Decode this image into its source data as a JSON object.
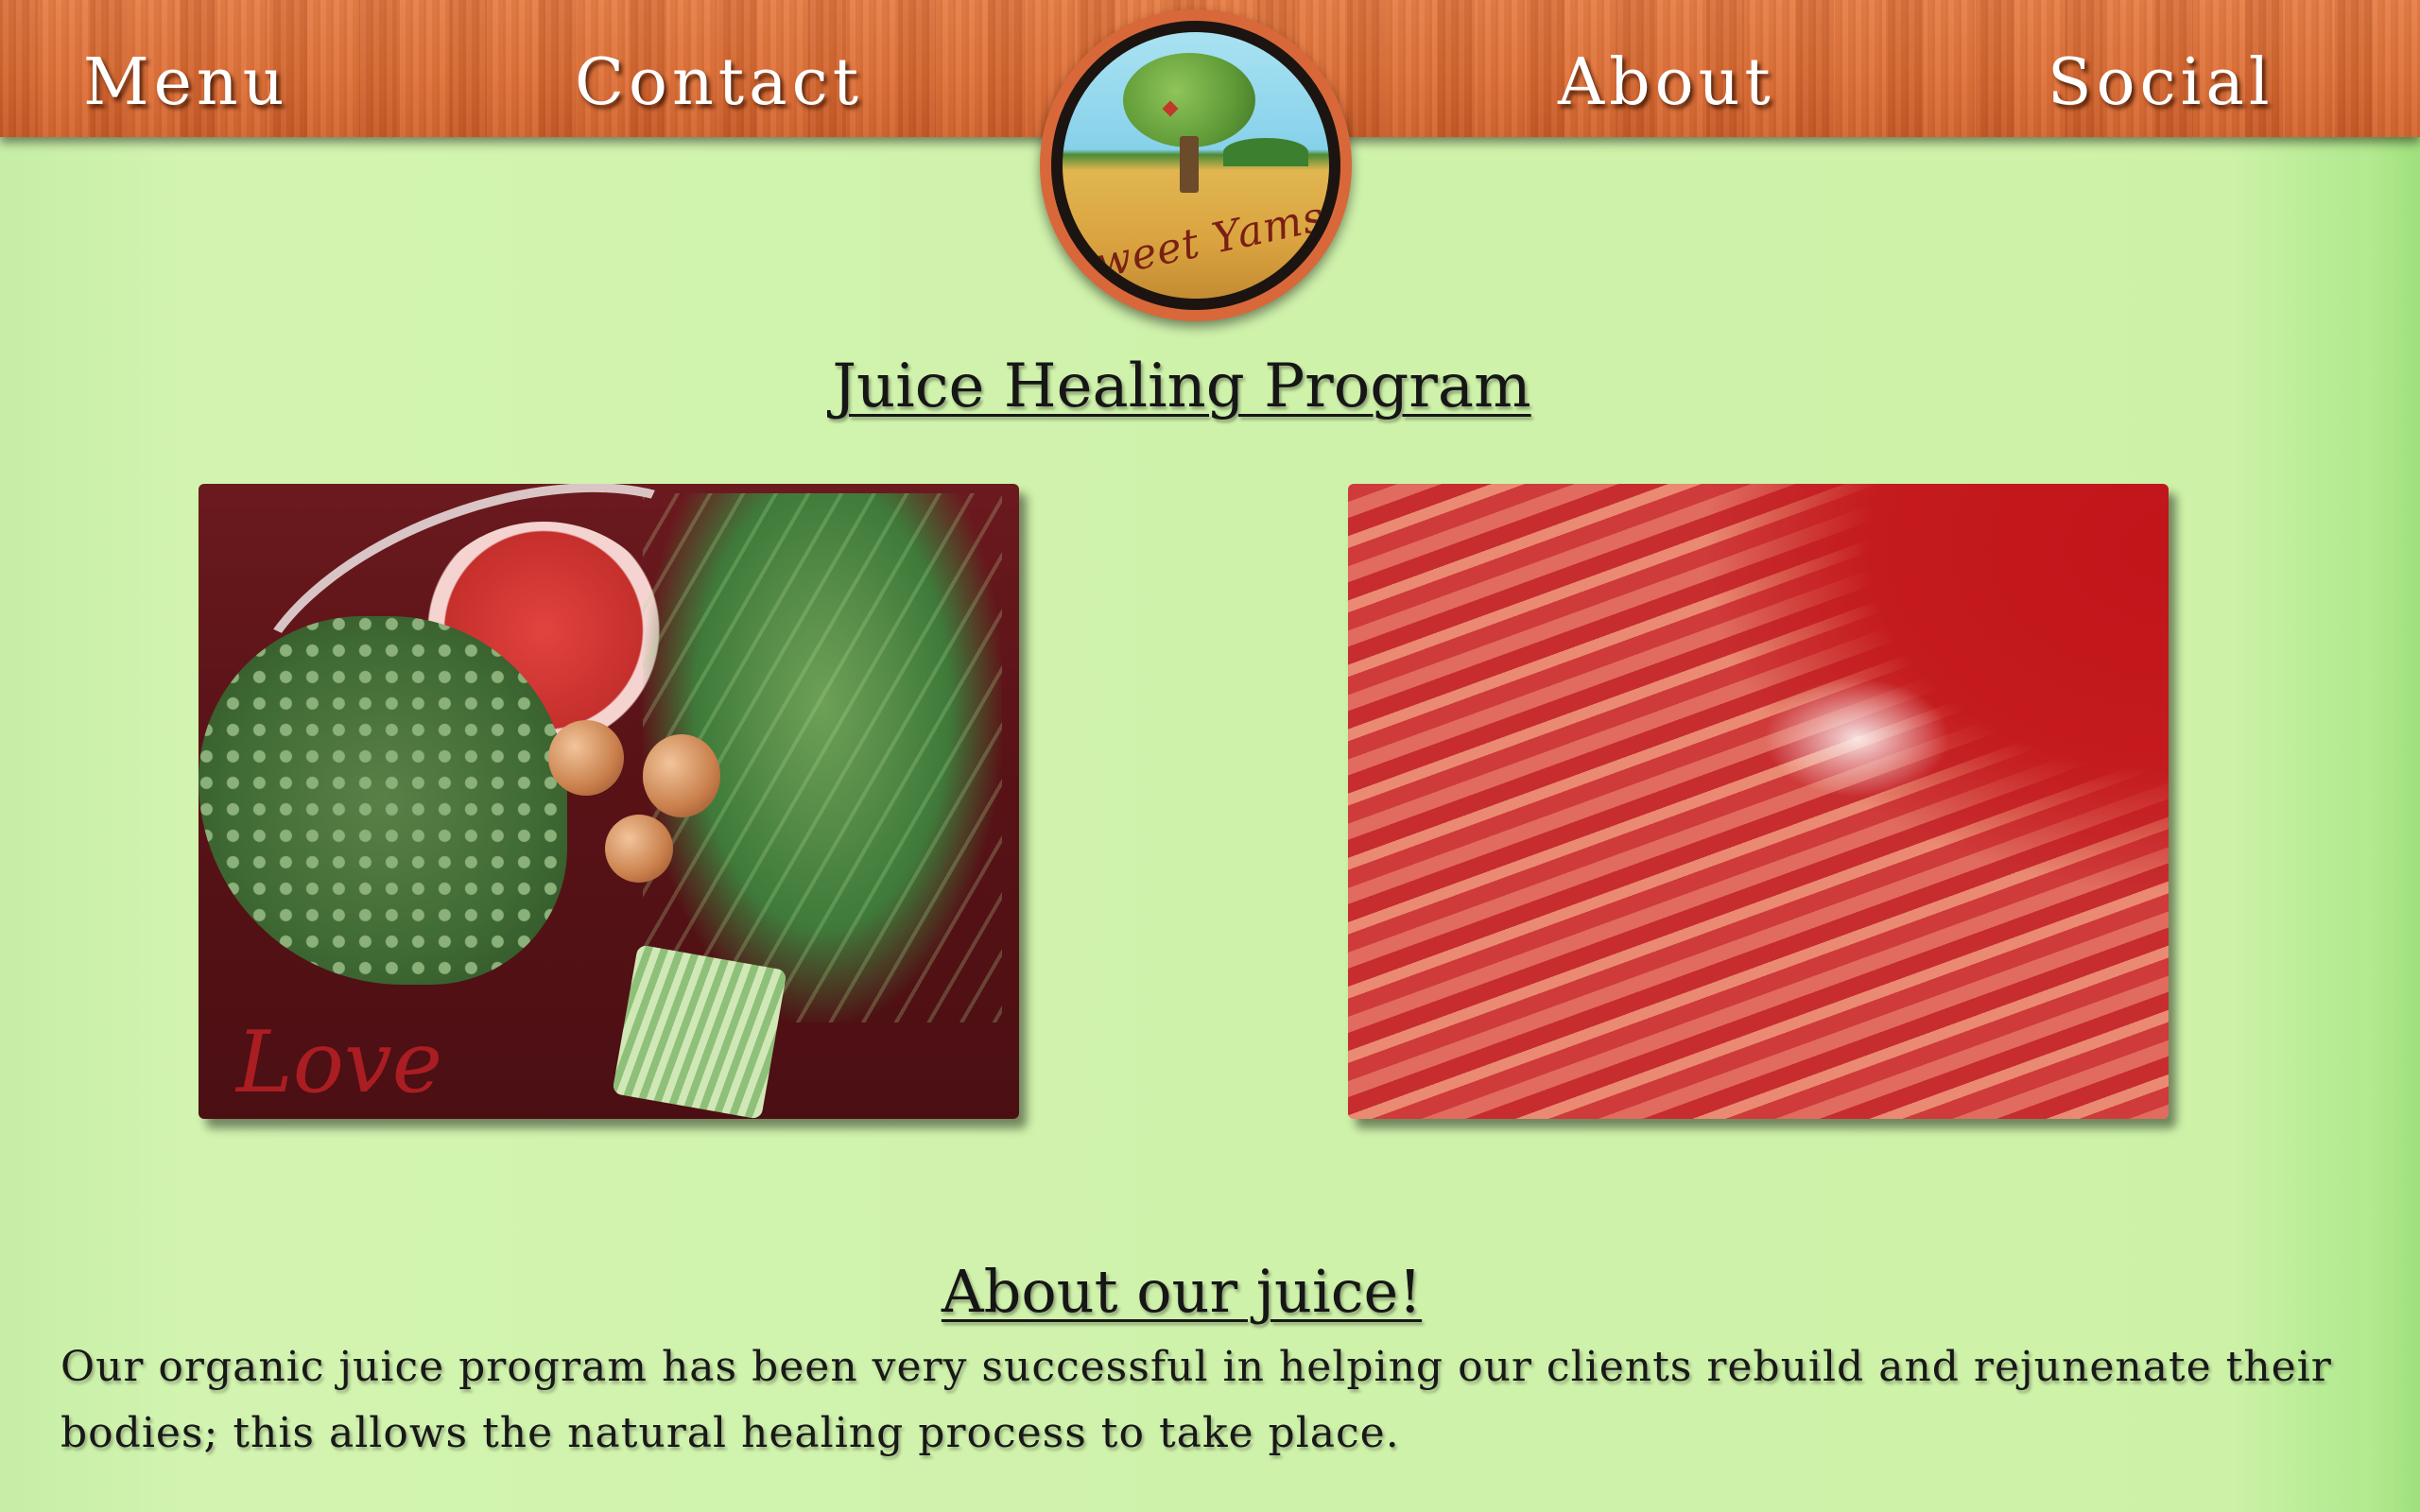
{
  "nav": {
    "items": [
      {
        "label": "Menu"
      },
      {
        "label": "Contact"
      },
      {
        "label": "About"
      },
      {
        "label": "Social"
      }
    ]
  },
  "logo": {
    "text": "Sweet Yams"
  },
  "main": {
    "title": "Juice Healing Program",
    "photo_veg_text": "Love",
    "about_heading": "About our juice!",
    "about_text": "Our organic juice program has been very successful in helping our clients rebuild and rejunenate their bodies; this allows the natural healing process to take place."
  },
  "colors": {
    "background": "#cff2ab",
    "navbar": "#dd6d35",
    "text": "#181818"
  }
}
